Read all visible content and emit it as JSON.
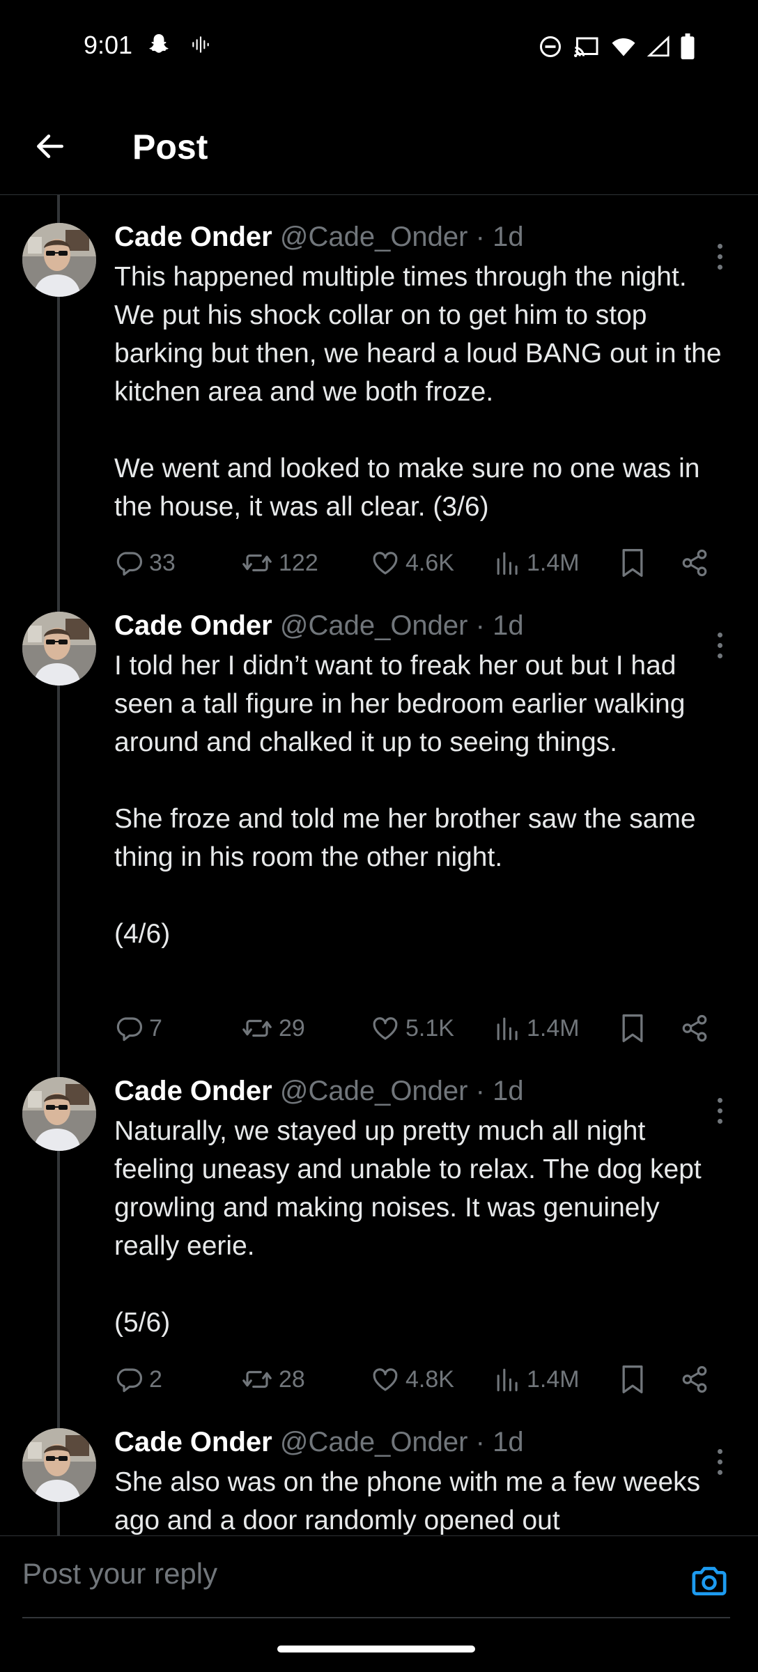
{
  "status_bar": {
    "time": "9:01",
    "icons_left": [
      "snapchat-icon",
      "voice-icon"
    ],
    "icons_right": [
      "dnd-icon",
      "cast-icon",
      "wifi-icon",
      "signal-icon",
      "battery-icon"
    ]
  },
  "header": {
    "title": "Post",
    "back_icon": "back-arrow-icon"
  },
  "posts": [
    {
      "author": "Cade Onder",
      "handle": "@Cade_Onder",
      "separator": "·",
      "time": "1d",
      "paragraphs": [
        "This happened multiple times through the night. We put his shock collar on to get him to stop barking but then, we heard a loud BANG out in the kitchen area and we both froze.",
        "We went and looked to make sure no one was in the house, it was all clear. (3/6)"
      ],
      "replies": "33",
      "reposts": "122",
      "likes": "4.6K",
      "views": "1.4M"
    },
    {
      "author": "Cade Onder",
      "handle": "@Cade_Onder",
      "separator": "·",
      "time": "1d",
      "paragraphs": [
        "I told her I didn’t want to freak her out but I had seen a tall figure in her bedroom earlier walking around and chalked it up to seeing things.",
        "She froze and told me her brother saw the same thing in his room the other night.",
        "(4/6)"
      ],
      "replies": "7",
      "reposts": "29",
      "likes": "5.1K",
      "views": "1.4M"
    },
    {
      "author": "Cade Onder",
      "handle": "@Cade_Onder",
      "separator": "·",
      "time": "1d",
      "paragraphs": [
        "Naturally, we stayed up pretty much all night feeling uneasy and unable to relax. The dog kept growling and making noises. It was genuinely really eerie.",
        "(5/6)"
      ],
      "replies": "2",
      "reposts": "28",
      "likes": "4.8K",
      "views": "1.4M"
    },
    {
      "author": "Cade Onder",
      "handle": "@Cade_Onder",
      "separator": "·",
      "time": "1d",
      "paragraphs": [
        "She also was on the phone with me a few weeks ago and a door randomly opened out"
      ]
    }
  ],
  "reply_bar": {
    "placeholder": "Post your reply",
    "camera_icon": "camera-icon"
  },
  "colors": {
    "background": "#000000",
    "text": "#e7e9ea",
    "muted": "#71767b",
    "accent": "#1d9bf0",
    "divider": "#2f3336"
  }
}
